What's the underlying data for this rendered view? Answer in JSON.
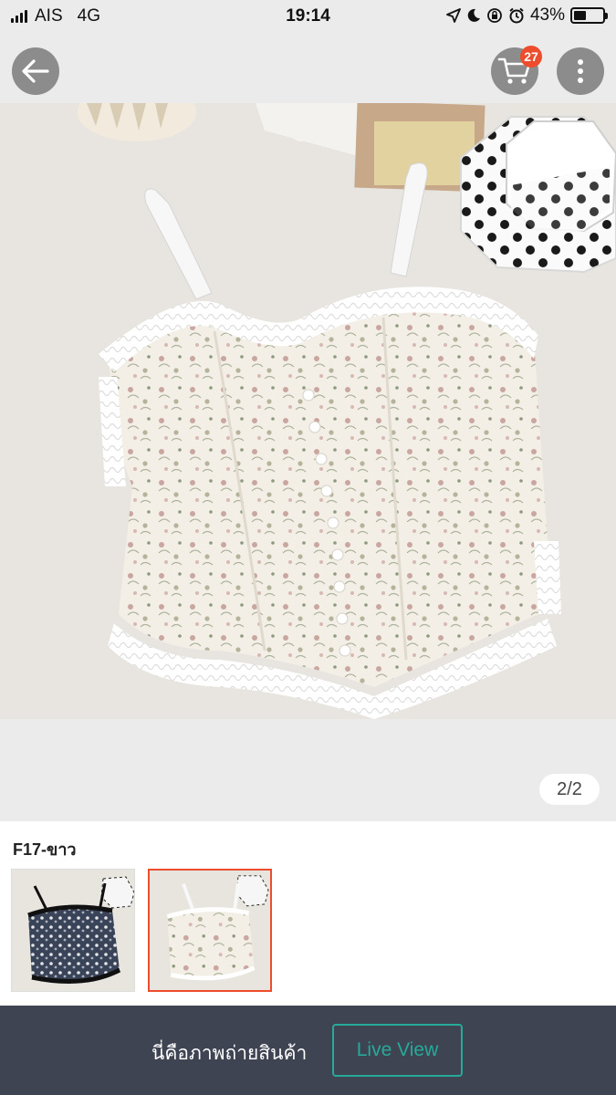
{
  "status_bar": {
    "carrier": "AIS",
    "network": "4G",
    "time": "19:14",
    "battery": "43%",
    "battery_level": 0.43
  },
  "header": {
    "cart_count": "27",
    "icons": [
      "back-arrow-icon",
      "cart-icon",
      "more-vertical-icon"
    ]
  },
  "gallery": {
    "counter": "2/2"
  },
  "variant": {
    "label": "F17-ขาว",
    "options": [
      {
        "name": "black-floral",
        "selected": false
      },
      {
        "name": "white-floral",
        "selected": true
      }
    ]
  },
  "bottom_bar": {
    "text": "นี่คือภาพถ่ายสินค้า",
    "button_label": "Live View"
  },
  "colors": {
    "accent": "#ee4d2d",
    "live_button": "#26aa99",
    "bottom_bar": "#3f4453"
  }
}
